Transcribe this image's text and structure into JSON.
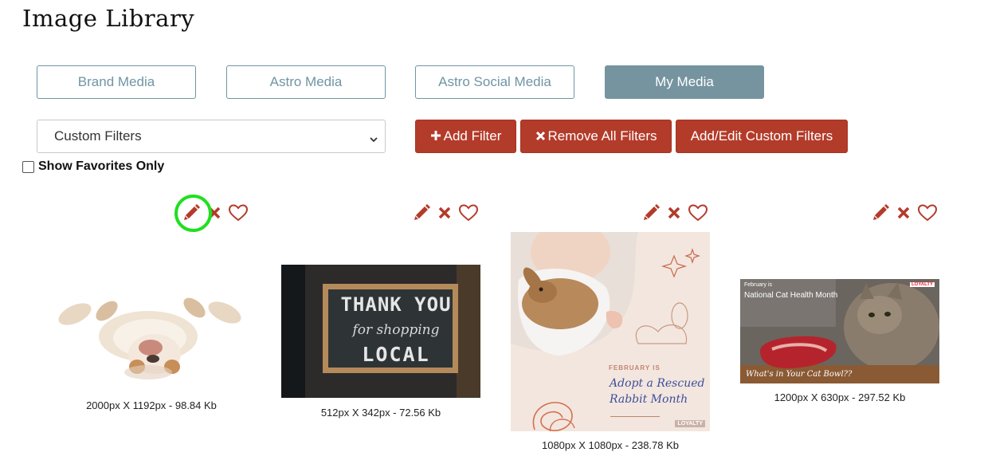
{
  "page_title": "Image Library",
  "tabs": [
    {
      "label": "Brand Media",
      "active": false
    },
    {
      "label": "Astro Media",
      "active": false
    },
    {
      "label": "Astro Social Media",
      "active": false
    },
    {
      "label": "My Media",
      "active": true
    }
  ],
  "filters": {
    "select_value": "Custom Filters",
    "add_filter_label": "Add Filter",
    "remove_all_label": "Remove All Filters",
    "add_edit_custom_label": "Add/Edit Custom Filters",
    "show_favorites_label": "Show Favorites Only",
    "show_favorites_checked": false
  },
  "colors": {
    "accent_red": "#b33b2a",
    "tab_teal": "#75949f",
    "highlight_green": "#1fe01f"
  },
  "images": [
    {
      "caption": "2000px X 1192px - 98.84 Kb",
      "subject": "bulldog lying on back"
    },
    {
      "caption": "512px X 342px - 72.56 Kb",
      "subject": "chalkboard sign",
      "sign_line1": "THANK YOU",
      "sign_line2": "for shopping",
      "sign_line3": "LOCAL"
    },
    {
      "caption": "1080px X 1080px - 238.78 Kb",
      "subject": "woman holding rabbit",
      "lead": "FEBRUARY IS",
      "headline1": "Adopt a Rescued",
      "headline2": "Rabbit Month",
      "brand": "LOYALTY"
    },
    {
      "caption": "1200px X 630px - 297.52 Kb",
      "subject": "cat eating raw meat",
      "lead": "February is",
      "headline": "National Cat Health Month",
      "footer": "What's in Your Cat Bowl??",
      "brand": "LOYALTY"
    }
  ],
  "icons": [
    "edit-pencil-icon",
    "delete-x-icon",
    "favorite-heart-icon"
  ]
}
